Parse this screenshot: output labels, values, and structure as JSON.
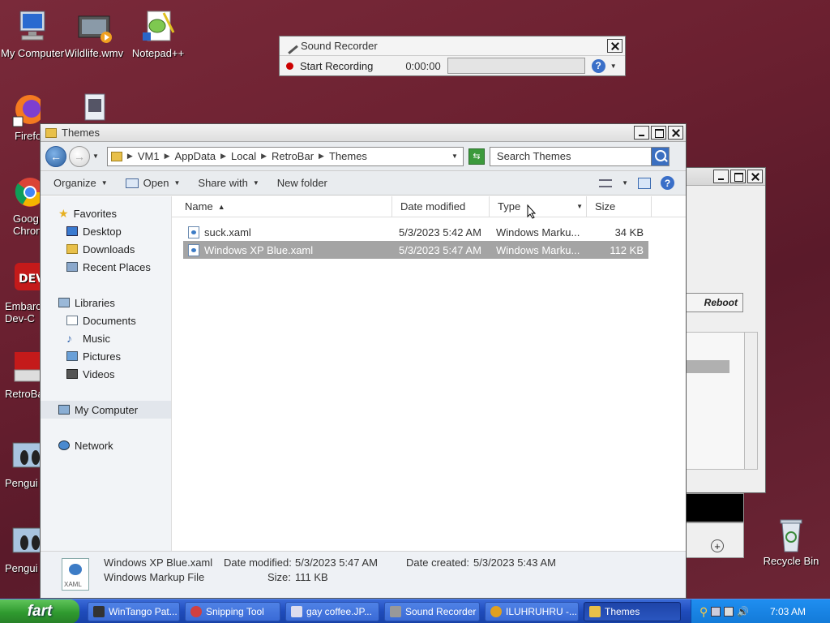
{
  "desktop": {
    "icons": [
      {
        "label": "My Computer",
        "icon": "my-computer-icon"
      },
      {
        "label": "Wildlife.wmv",
        "icon": "video-file-icon"
      },
      {
        "label": "Notepad++",
        "icon": "notepadpp-icon"
      },
      {
        "label": "Firefo",
        "icon": "firefox-icon"
      },
      {
        "label": "Goog Chron",
        "icon": "chrome-icon"
      },
      {
        "label": "Embarc Dev-C",
        "icon": "devcpp-icon"
      },
      {
        "label": "RetroBa",
        "icon": "retrobar-icon"
      },
      {
        "label": "Pengui",
        "icon": "penguin-image-icon"
      },
      {
        "label": "Pengui",
        "icon": "penguin-image-icon"
      },
      {
        "label": "Recycle Bin",
        "icon": "recycle-bin-icon"
      }
    ]
  },
  "sound_recorder": {
    "title": "Sound Recorder",
    "start_label": "Start Recording",
    "time": "0:00:00"
  },
  "explorer": {
    "title": "Themes",
    "breadcrumb": [
      "VM1",
      "AppData",
      "Local",
      "RetroBar",
      "Themes"
    ],
    "search_placeholder": "Search Themes",
    "commands": {
      "organize": "Organize",
      "open": "Open",
      "share_with": "Share with",
      "new_folder": "New folder"
    },
    "nav": {
      "favorites": "Favorites",
      "favorites_items": [
        "Desktop",
        "Downloads",
        "Recent Places"
      ],
      "libraries": "Libraries",
      "libraries_items": [
        "Documents",
        "Music",
        "Pictures",
        "Videos"
      ],
      "my_computer": "My Computer",
      "network": "Network"
    },
    "columns": {
      "name": "Name",
      "date_modified": "Date modified",
      "type": "Type",
      "size": "Size"
    },
    "files": [
      {
        "name": "suck.xaml",
        "date": "5/3/2023 5:42 AM",
        "type": "Windows Marku...",
        "size": "34 KB",
        "selected": false
      },
      {
        "name": "Windows XP Blue.xaml",
        "date": "5/3/2023 5:47 AM",
        "type": "Windows Marku...",
        "size": "112 KB",
        "selected": true
      }
    ],
    "details": {
      "filename": "Windows XP Blue.xaml",
      "filetype": "Windows Markup File",
      "date_modified_label": "Date modified:",
      "date_modified": "5/3/2023 5:47 AM",
      "date_created_label": "Date created:",
      "date_created": "5/3/2023 5:43 AM",
      "size_label": "Size:",
      "size": "111 KB",
      "icon_text": "XAML"
    }
  },
  "background_window": {
    "button_label": "Reboot"
  },
  "taskbar": {
    "start_label": "fart",
    "tasks": [
      {
        "label": "WinTango Pat...",
        "active": false
      },
      {
        "label": "Snipping Tool",
        "active": false
      },
      {
        "label": "gay coffee.JP...",
        "active": false
      },
      {
        "label": "Sound Recorder",
        "active": false
      },
      {
        "label": "ILUHRUHRU -...",
        "active": false
      },
      {
        "label": "Themes",
        "active": true
      }
    ],
    "clock": "7:03 AM"
  }
}
